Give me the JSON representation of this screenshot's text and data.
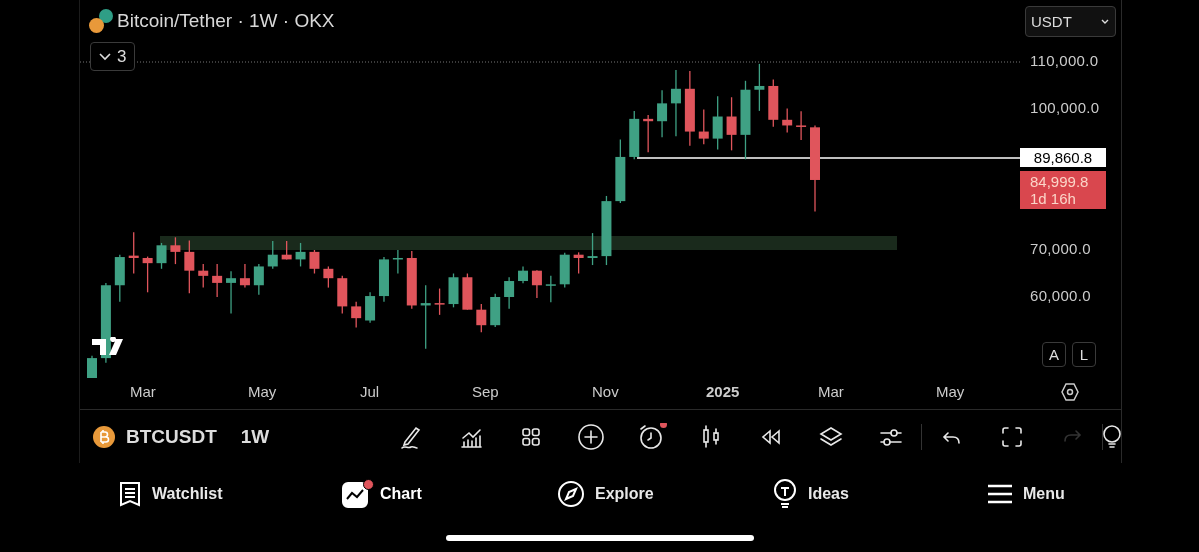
{
  "header": {
    "title": "Bitcoin/Tether · 1W · OKX",
    "indicators_toggle": "3",
    "currency": "USDT"
  },
  "price_axis": {
    "labels": [
      "110,000.0",
      "100,000.0",
      "70,000.0",
      "60,000.0"
    ],
    "marked_price": "89,860.8",
    "last_price": "84,999.8",
    "countdown": "1d 16h",
    "scale_buttons": [
      "A",
      "L"
    ]
  },
  "time_axis": [
    {
      "label": "Mar",
      "kind": "month"
    },
    {
      "label": "May",
      "kind": "month"
    },
    {
      "label": "Jul",
      "kind": "month"
    },
    {
      "label": "Sep",
      "kind": "month"
    },
    {
      "label": "Nov",
      "kind": "month"
    },
    {
      "label": "2025",
      "kind": "year"
    },
    {
      "label": "Mar",
      "kind": "month"
    },
    {
      "label": "May",
      "kind": "month"
    }
  ],
  "symbol_bar": {
    "symbol": "BTCUSDT",
    "interval": "1W"
  },
  "tools": [
    {
      "kind": "draw",
      "disabled": false,
      "badge": false
    },
    {
      "kind": "indicators",
      "disabled": false,
      "badge": false
    },
    {
      "kind": "templates",
      "disabled": false,
      "badge": false
    },
    {
      "kind": "add",
      "disabled": false,
      "badge": false
    },
    {
      "kind": "alert",
      "disabled": false,
      "badge": true
    },
    {
      "kind": "candles",
      "disabled": false,
      "badge": false
    },
    {
      "kind": "replay",
      "disabled": false,
      "badge": false
    },
    {
      "kind": "layers",
      "disabled": false,
      "badge": false
    },
    {
      "kind": "settings",
      "disabled": false,
      "badge": false
    },
    {
      "kind": "separator"
    },
    {
      "kind": "undo",
      "disabled": false,
      "badge": false
    },
    {
      "kind": "fullscreen",
      "disabled": false,
      "badge": false
    },
    {
      "kind": "redo",
      "disabled": true,
      "badge": false
    },
    {
      "kind": "separator"
    },
    {
      "kind": "ideas",
      "disabled": false,
      "badge": false
    }
  ],
  "nav": [
    {
      "label": "Watchlist",
      "kind": "watchlist",
      "selected": false,
      "badge": false
    },
    {
      "label": "Chart",
      "kind": "chart",
      "selected": true,
      "badge": true
    },
    {
      "label": "Explore",
      "kind": "explore",
      "selected": false,
      "badge": false
    },
    {
      "label": "Ideas",
      "kind": "ideas",
      "selected": false,
      "badge": false
    },
    {
      "label": "Menu",
      "kind": "menu",
      "selected": false,
      "badge": false
    }
  ]
}
